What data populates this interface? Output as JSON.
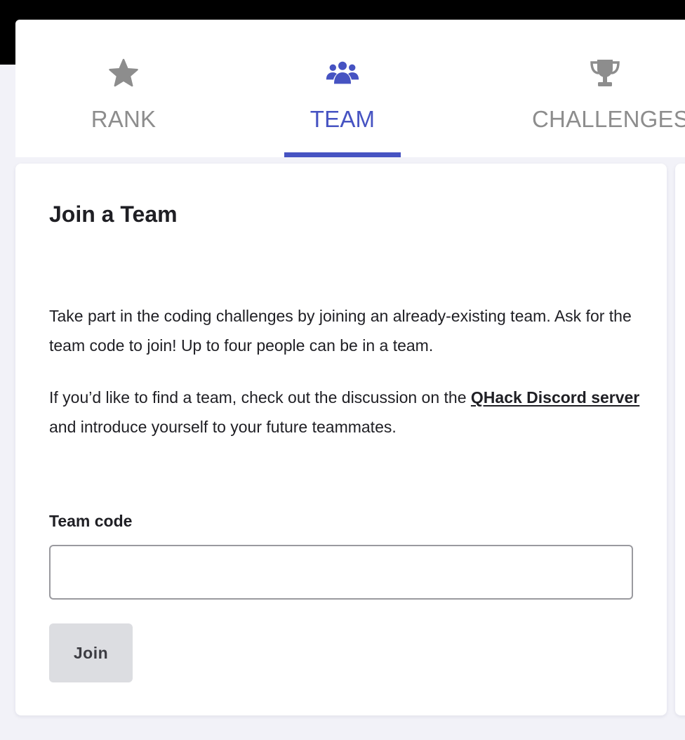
{
  "tabs": [
    {
      "id": "rank",
      "label": "RANK",
      "icon": "star-icon",
      "active": false
    },
    {
      "id": "team",
      "label": "TEAM",
      "icon": "users-icon",
      "active": true
    },
    {
      "id": "challenges",
      "label": "CHALLENGES",
      "icon": "trophy-icon",
      "active": false
    }
  ],
  "colors": {
    "accent": "#4653c2",
    "inactive": "#8d8d8d",
    "text": "#1f1f24",
    "button_disabled_bg": "#dcdde1"
  },
  "join_card": {
    "title": "Join a Team",
    "paragraph_1": "Take part in the coding challenges by joining an already-existing team. Ask for the team code to join! Up to four people can be in a team.",
    "paragraph_2_before": "If you’d like to find a team, check out the discussion on the ",
    "paragraph_2_link": "QHack Discord server",
    "paragraph_2_after": " and introduce yourself to your future teammates.",
    "field_label": "Team code",
    "field_value": "",
    "field_placeholder": "",
    "button_label": "Join"
  }
}
